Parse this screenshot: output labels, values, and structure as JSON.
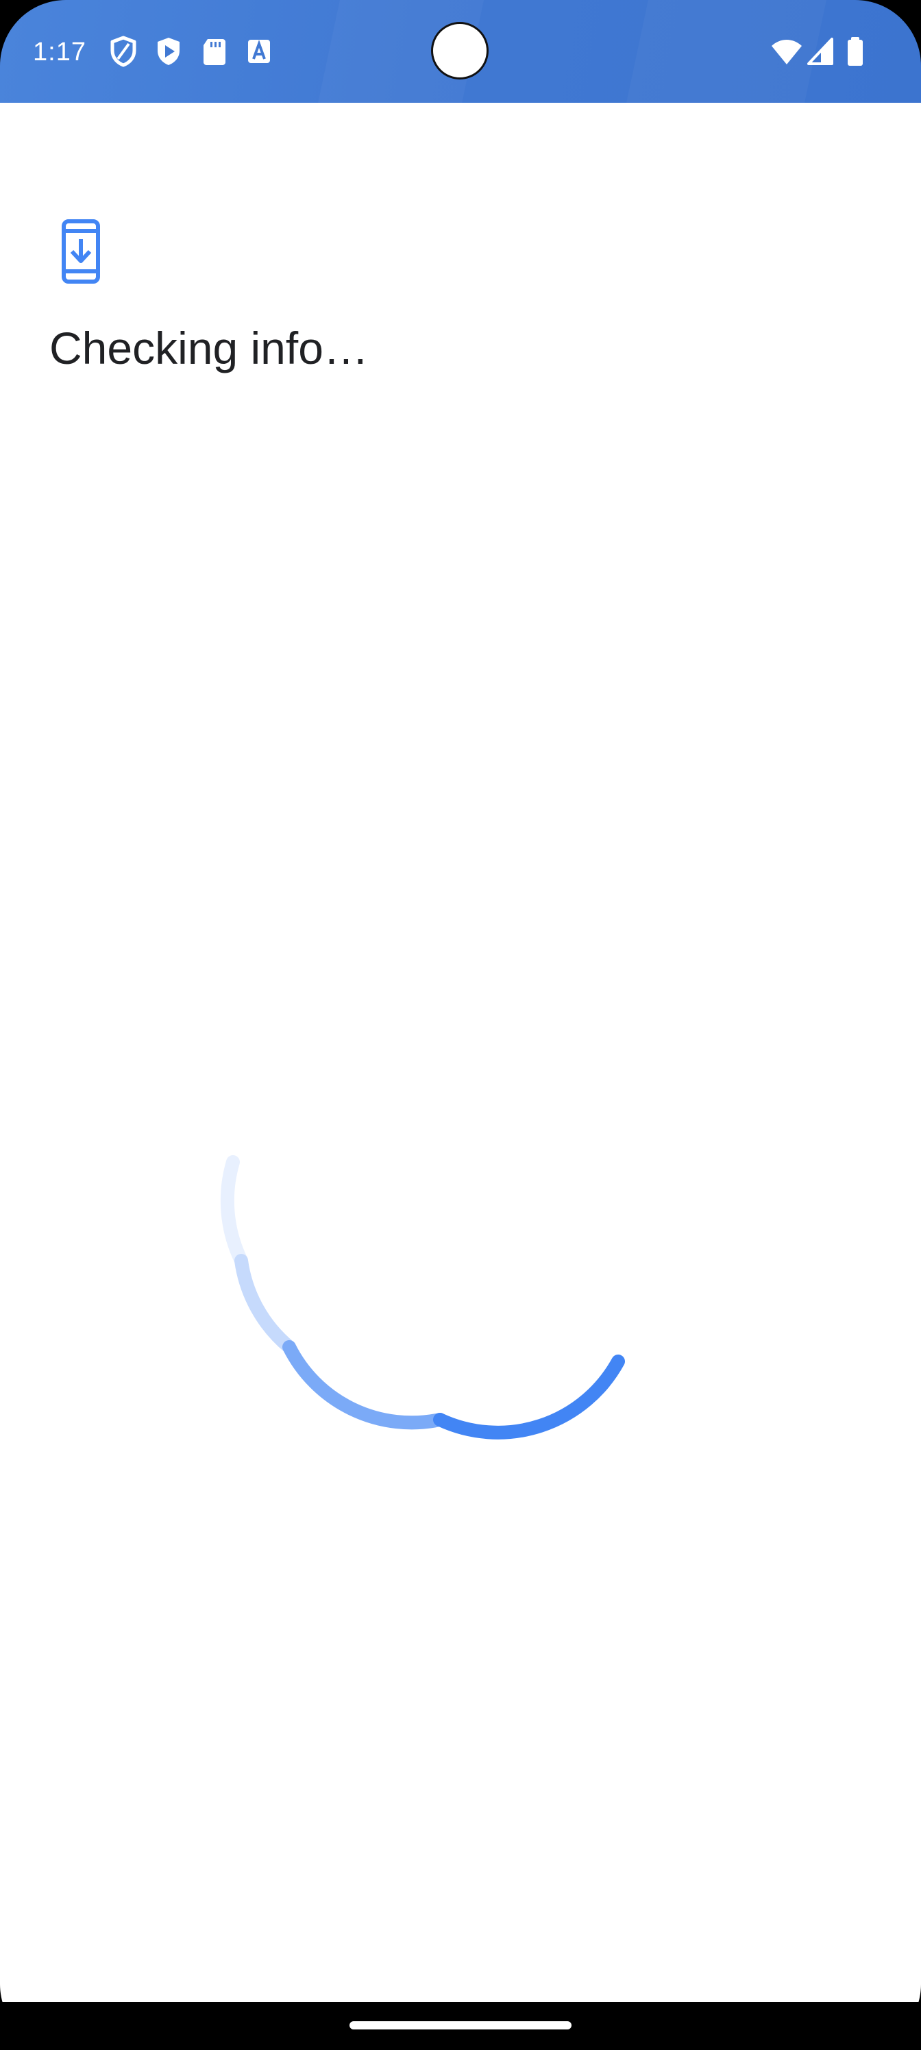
{
  "status_bar": {
    "time": "1:17",
    "left_icons": [
      "shield-icon",
      "play-protect-icon",
      "sd-card-icon",
      "text-app-icon"
    ],
    "right_icons": [
      "wifi-icon",
      "signal-icon",
      "battery-icon"
    ],
    "accent_color": "#4179d3"
  },
  "main": {
    "icon": "phone-download-icon",
    "heading": "Checking info…"
  },
  "progress": {
    "type": "indeterminate-spinner",
    "color": "#4285f4"
  },
  "navigation": {
    "handle": "home-gesture-handle"
  }
}
